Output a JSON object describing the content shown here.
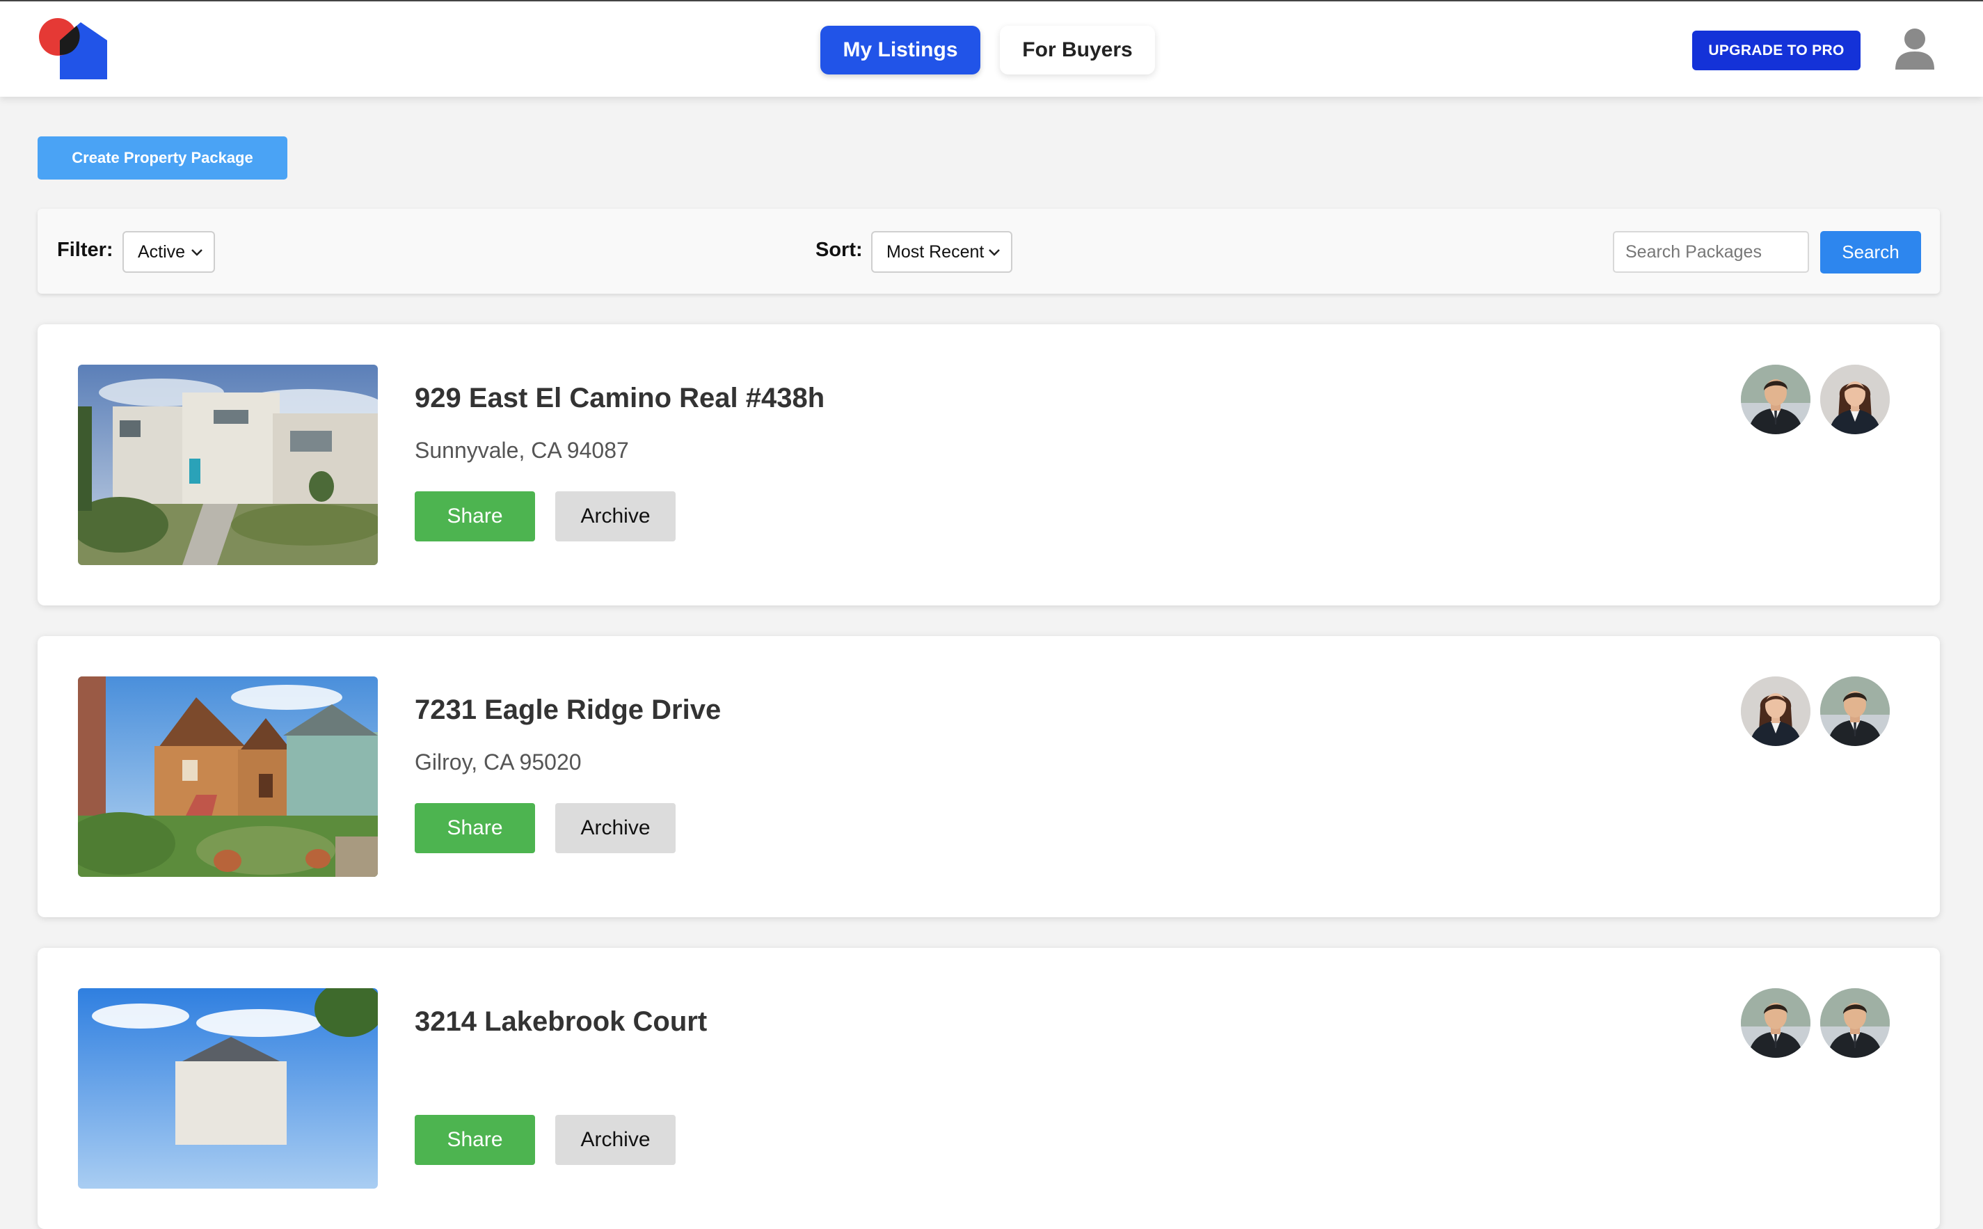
{
  "header": {
    "nav": [
      {
        "label": "My Listings",
        "active": true
      },
      {
        "label": "For Buyers",
        "active": false
      }
    ],
    "upgrade_label": "UPGRADE TO PRO",
    "logo_icon": "house-logo-icon",
    "user_icon": "user-icon"
  },
  "toolbar": {
    "create_label": "Create Property Package"
  },
  "filter_bar": {
    "filter_label": "Filter:",
    "filter_value": "Active",
    "sort_label": "Sort:",
    "sort_value": "Most Recent",
    "search_placeholder": "Search Packages",
    "search_button": "Search"
  },
  "listings": [
    {
      "title": "929 East El Camino Real #438h",
      "location": "Sunnyvale, CA 94087",
      "share_label": "Share",
      "archive_label": "Archive",
      "avatars": [
        "male-agent",
        "female-agent"
      ]
    },
    {
      "title": "7231 Eagle Ridge Drive",
      "location": "Gilroy, CA 95020",
      "share_label": "Share",
      "archive_label": "Archive",
      "avatars": [
        "female-agent",
        "male-agent"
      ]
    },
    {
      "title": "3214 Lakebrook Court",
      "location": "",
      "share_label": "Share",
      "archive_label": "Archive",
      "avatars": [
        "male-agent",
        "male-agent"
      ]
    }
  ],
  "colors": {
    "primary": "#2154e8",
    "upgrade": "#1432d8",
    "create": "#4aa3f5",
    "search": "#2d86ee",
    "share": "#4db450",
    "archive": "#dcdcdc",
    "logo_red": "#e53935"
  }
}
